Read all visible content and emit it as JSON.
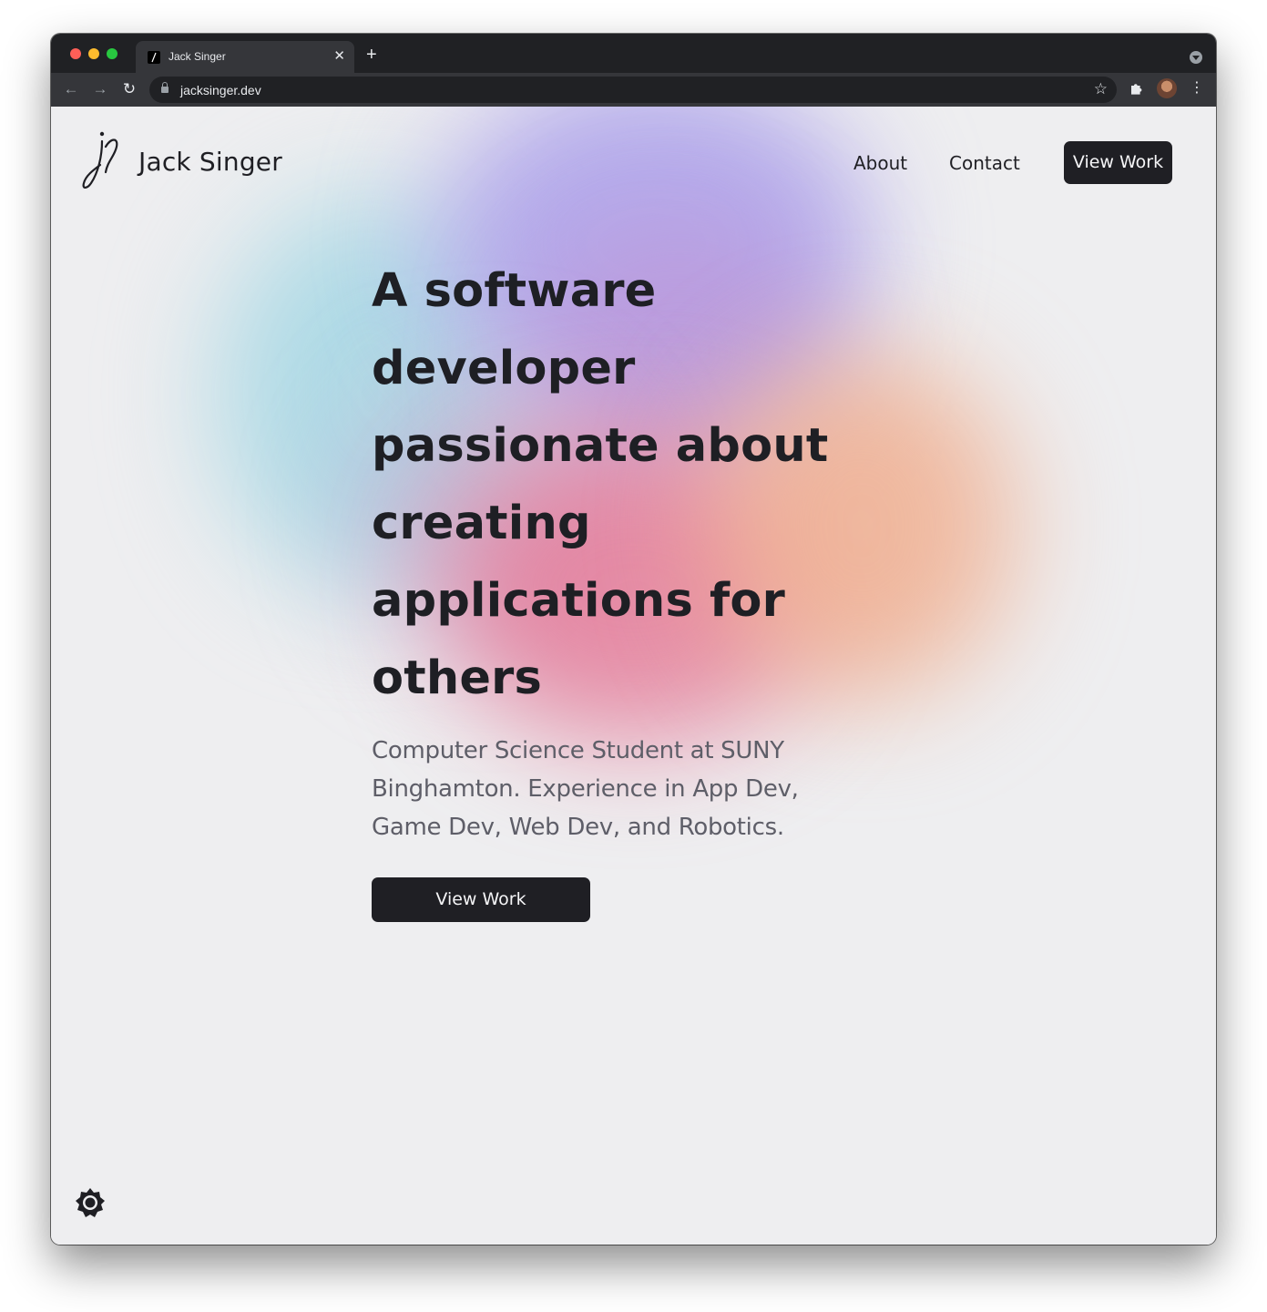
{
  "browser": {
    "tab_title": "Jack Singer",
    "tab_close": "✕",
    "new_tab": "+",
    "url": "jacksinger.dev",
    "back": "←",
    "forward": "→",
    "reload": "↻",
    "star": "☆",
    "menu": "⋮"
  },
  "header": {
    "brand": "Jack Singer",
    "nav": {
      "about": "About",
      "contact": "Contact",
      "cta": "View Work"
    }
  },
  "hero": {
    "headline_lines": [
      "A software",
      "developer",
      "passionate about",
      "creating",
      "applications for",
      "others"
    ],
    "subtext_lines": [
      "Computer Science Student at SUNY",
      "Binghamton. Experience in App Dev,",
      "Game Dev, Web Dev, and Robotics."
    ],
    "cta": "View Work"
  },
  "icons": {
    "logo": "js-signature-logo-icon",
    "theme_toggle": "sun-icon",
    "extensions": "puzzle-icon"
  },
  "colors": {
    "text_dark": "#1f1f24",
    "text_muted": "#5e5e68",
    "page_bg": "#eeeef0",
    "browser_dark": "#202124"
  }
}
